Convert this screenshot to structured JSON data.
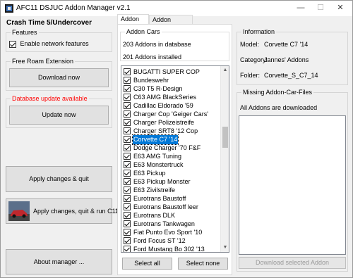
{
  "window": {
    "title": "AFC11 DSJUC Addon Manager v2.1",
    "controls": {
      "minimize": "—",
      "maximize": "☐",
      "close": "✕"
    }
  },
  "left": {
    "heading": "Crash Time 5/Undercover",
    "features": {
      "label": "Features",
      "checkbox_label": "Enable network features"
    },
    "free_roam": {
      "label": "Free Roam Extension",
      "button": "Download now"
    },
    "db_update": {
      "label": "Database update available",
      "label_color": "#ff0000",
      "button": "Update now"
    },
    "apply_button": "Apply changes & quit",
    "apply_run_button": "Apply changes, quit & run C11",
    "about_button": "About manager ..."
  },
  "tabs": [
    {
      "label": "Addon Cars"
    },
    {
      "label": "Addon Sceneries"
    }
  ],
  "addon_cars": {
    "label": "Addon Cars",
    "in_database": "203 Addons in database",
    "installed": "201 Addons installed",
    "items": [
      "BUGATTI SUPER COP",
      "Bundeswehr",
      "C30 T5 R-Design",
      "C63 AMG BlackSeries",
      "Cadillac Eldorado '59",
      "Charger Cop 'Geiger Cars'",
      "Charger Polizeistreife",
      "Charger SRT8 '12 Cop",
      "Corvette C7 '14",
      "Dodge Charger '70 F&F",
      "E63 AMG Tuning",
      "E63 Monstertruck",
      "E63 Pickup",
      "E63 Pickup Monster",
      "E63 Zivilstreife",
      "Eurotrans Baustoff",
      "Eurotrans Baustoff leer",
      "Eurotrans DLK",
      "Eurotrans Tankwagen",
      "Fiat Punto Evo Sport '10",
      "Ford Focus ST '12",
      "Ford Mustang Bo 302 '13"
    ],
    "selected_item": "Corvette C7 '14",
    "select_all": "Select all",
    "select_none": "Select none"
  },
  "information": {
    "label": "Information",
    "model_label": "Model:",
    "model_value": "Corvette C7 '14",
    "category_label": "Category:",
    "category_value": "Jannes' Addons",
    "folder_label": "Folder:",
    "folder_value": "Corvette_S_C7_14"
  },
  "missing": {
    "label": "Missing Addon-Car-Files",
    "status": "All Addons are downloaded",
    "download_button": "Download selected Addon"
  },
  "colors": {
    "accent": "#0078d7"
  }
}
